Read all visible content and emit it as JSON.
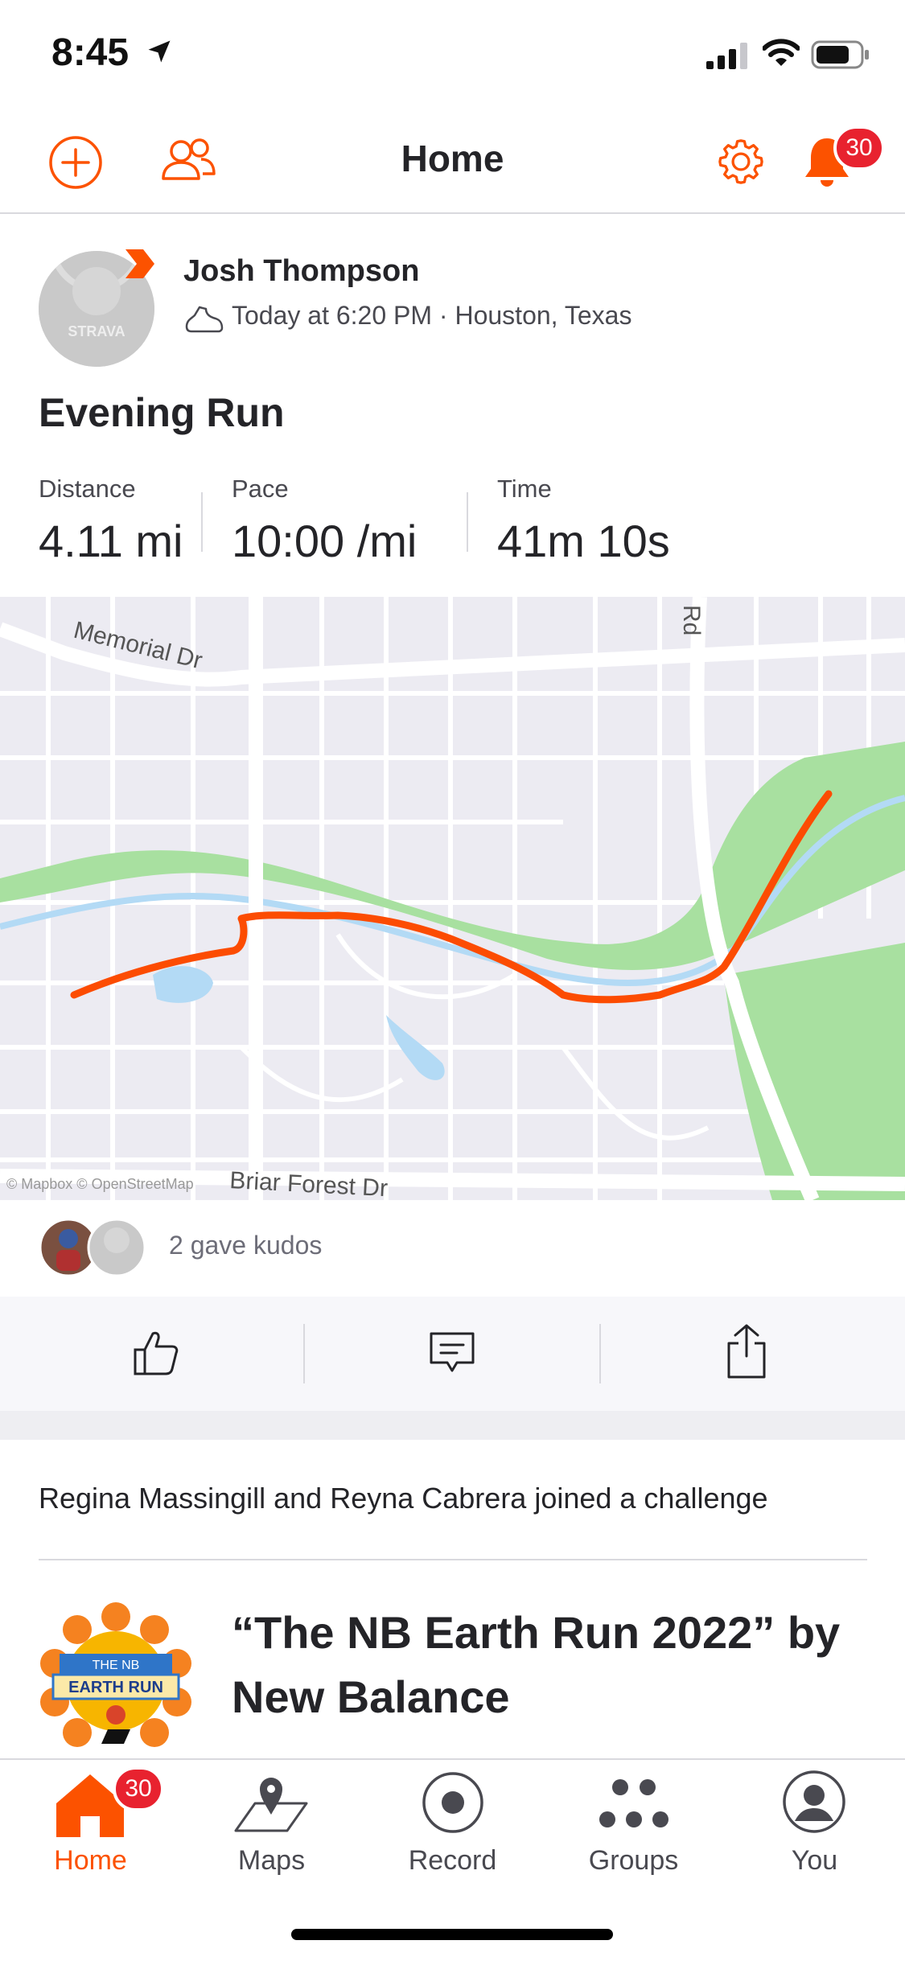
{
  "status_bar": {
    "time": "8:45"
  },
  "header": {
    "title": "Home",
    "notification_count": "30"
  },
  "activity": {
    "athlete": "Josh Thompson",
    "avatar_text": "STRAVA",
    "meta": "Today at 6:20 PM · Houston, Texas",
    "title": "Evening Run",
    "stats": [
      {
        "label": "Distance",
        "value": "4.11 mi"
      },
      {
        "label": "Pace",
        "value": "10:00 /mi"
      },
      {
        "label": "Time",
        "value": "41m 10s"
      }
    ],
    "map": {
      "street_labels": [
        "Memorial Dr",
        "Rd",
        "Briar Forest Dr"
      ],
      "attribution": "© Mapbox © OpenStreetMap",
      "route_color": "#fc4c02"
    },
    "kudos": "2 gave kudos"
  },
  "challenge": {
    "joined_text": "Regina Massingill and Reyna Cabrera joined a challenge",
    "name": "“The NB Earth Run 2022” by New Balance",
    "badge_line1": "THE NB",
    "badge_line2": "EARTH RUN"
  },
  "tabbar": {
    "items": [
      {
        "label": "Home",
        "icon": "home-icon",
        "badge": "30"
      },
      {
        "label": "Maps",
        "icon": "map-icon"
      },
      {
        "label": "Record",
        "icon": "record-icon"
      },
      {
        "label": "Groups",
        "icon": "groups-icon"
      },
      {
        "label": "You",
        "icon": "profile-icon"
      }
    ]
  },
  "colors": {
    "brand": "#fc5200",
    "badge": "#e8222f",
    "park": "#a8e0a0",
    "water": "#b3daf5"
  }
}
